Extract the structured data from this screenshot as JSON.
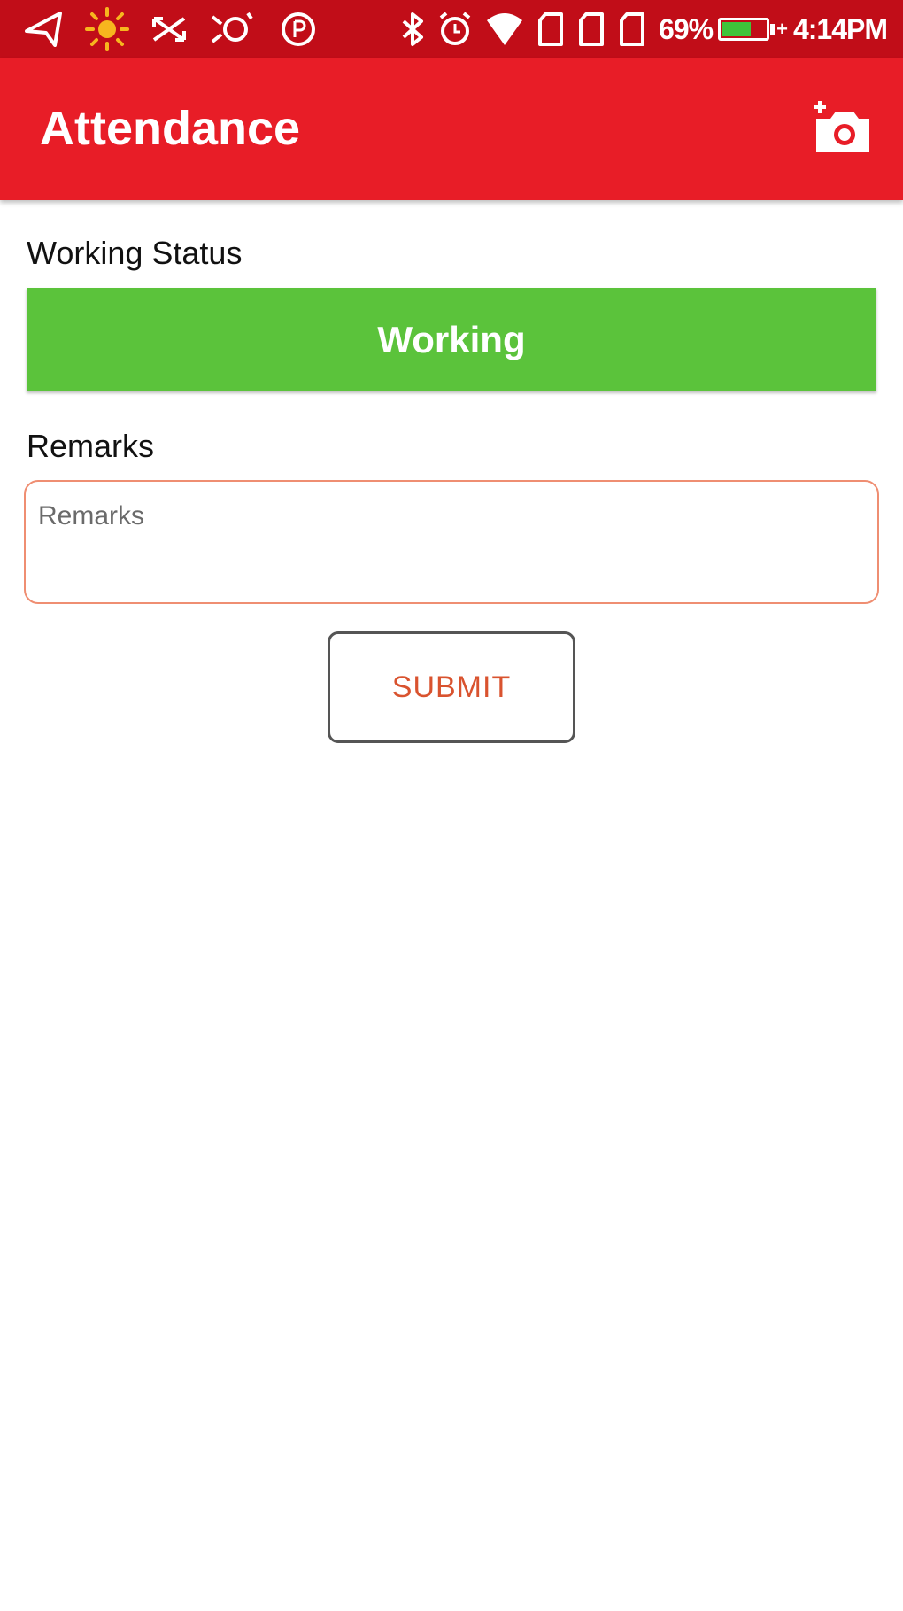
{
  "status_bar": {
    "battery_percent": "69%",
    "battery_level": 0.69,
    "time": "4:14PM",
    "icons_left": [
      "navigation-icon",
      "sun-icon",
      "cross-arrows-icon",
      "smart-icon",
      "circle-icon"
    ],
    "icons_right": [
      "bluetooth-icon",
      "alarm-icon",
      "wifi-icon",
      "sim-card-icon",
      "sim-card-icon",
      "sd-card-icon",
      "battery-icon"
    ]
  },
  "app_bar": {
    "title": "Attendance",
    "action_icon": "add-camera-icon"
  },
  "form": {
    "working_status_label": "Working Status",
    "working_status_value": "Working",
    "remarks_label": "Remarks",
    "remarks_value": "",
    "remarks_placeholder": "Remarks",
    "submit_label": "SUBMIT"
  },
  "colors": {
    "status_bar_bg": "#c10d18",
    "app_bar_bg": "#e81d27",
    "working_green": "#5bc33b",
    "remarks_border": "#ef8e72",
    "submit_text": "#d9532f"
  }
}
